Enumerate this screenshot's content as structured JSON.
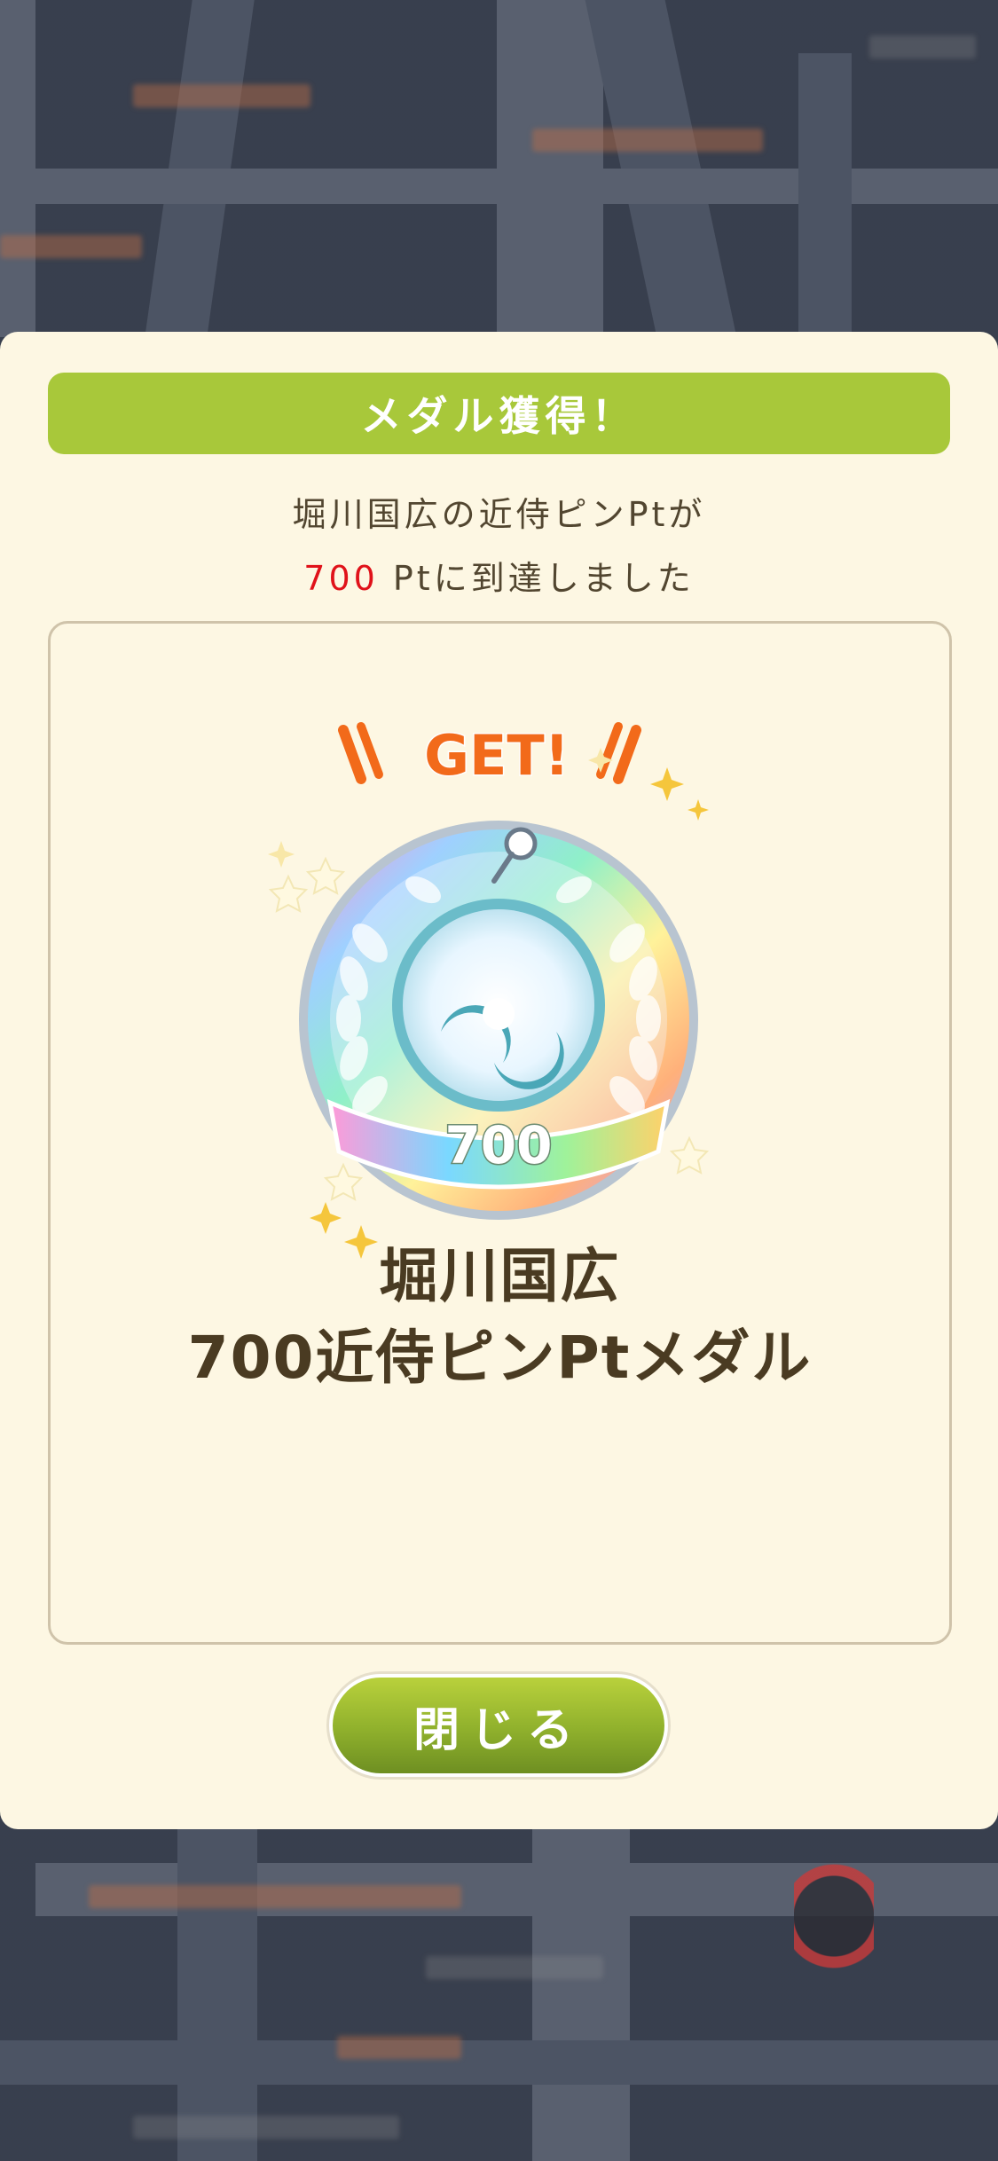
{
  "dialog": {
    "header_label": "メダル獲得！",
    "message_line1": "堀川国広の近侍ピンPtが",
    "message_value": "700",
    "message_line2_rest": " Ptに到達しました",
    "medal": {
      "get_text": "\\GET!/",
      "badge_number": "700",
      "title_line1": "堀川国広",
      "title_line2": "700近侍ピンPtメダル"
    },
    "close_label": "閉じる"
  },
  "colors": {
    "header_green": "#a8c83a",
    "value_red": "#e0121a",
    "panel_cream": "#fdf7e3"
  }
}
